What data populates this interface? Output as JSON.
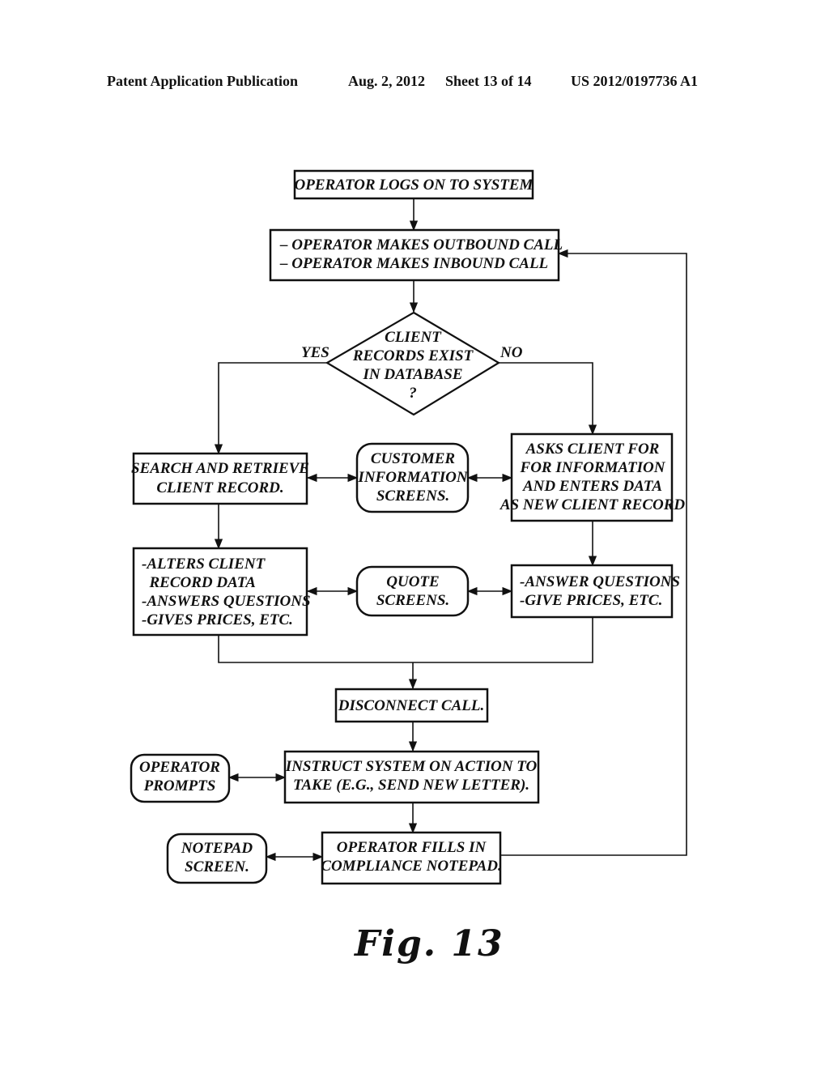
{
  "header": {
    "publication": "Patent Application Publication",
    "date": "Aug. 2, 2012",
    "sheet": "Sheet 13 of 14",
    "number": "US 2012/0197736 A1"
  },
  "figure_label": "Fig. 13",
  "nodes": {
    "logon": [
      "OPERATOR LOGS ON TO SYSTEM"
    ],
    "calls": [
      "– OPERATOR MAKES OUTBOUND CALL",
      "– OPERATOR MAKES INBOUND CALL"
    ],
    "decision": [
      "CLIENT",
      "RECORDS EXIST",
      "IN DATABASE",
      "?"
    ],
    "yes_label": "YES",
    "no_label": "NO",
    "search": [
      "SEARCH AND RETRIEVE",
      "CLIENT RECORD."
    ],
    "customer_screens": [
      "CUSTOMER",
      "INFORMATION",
      "SCREENS."
    ],
    "asks_client": [
      "ASKS CLIENT FOR",
      "FOR INFORMATION",
      "AND ENTERS DATA",
      "AS NEW CLIENT RECORD"
    ],
    "alters": [
      "-ALTERS CLIENT",
      "  RECORD DATA",
      "-ANSWERS QUESTIONS",
      "-GIVES PRICES, ETC."
    ],
    "quote_screens": [
      "QUOTE",
      "SCREENS."
    ],
    "answer": [
      "-ANSWER QUESTIONS",
      "-GIVE PRICES, ETC."
    ],
    "disconnect": [
      "DISCONNECT CALL."
    ],
    "operator_prompts": [
      "OPERATOR",
      "PROMPTS"
    ],
    "instruct": [
      "INSTRUCT SYSTEM ON ACTION TO",
      "TAKE (E.G., SEND NEW LETTER)."
    ],
    "notepad_screen": [
      "NOTEPAD",
      "SCREEN."
    ],
    "compliance": [
      "OPERATOR FILLS IN",
      "COMPLIANCE NOTEPAD."
    ]
  }
}
